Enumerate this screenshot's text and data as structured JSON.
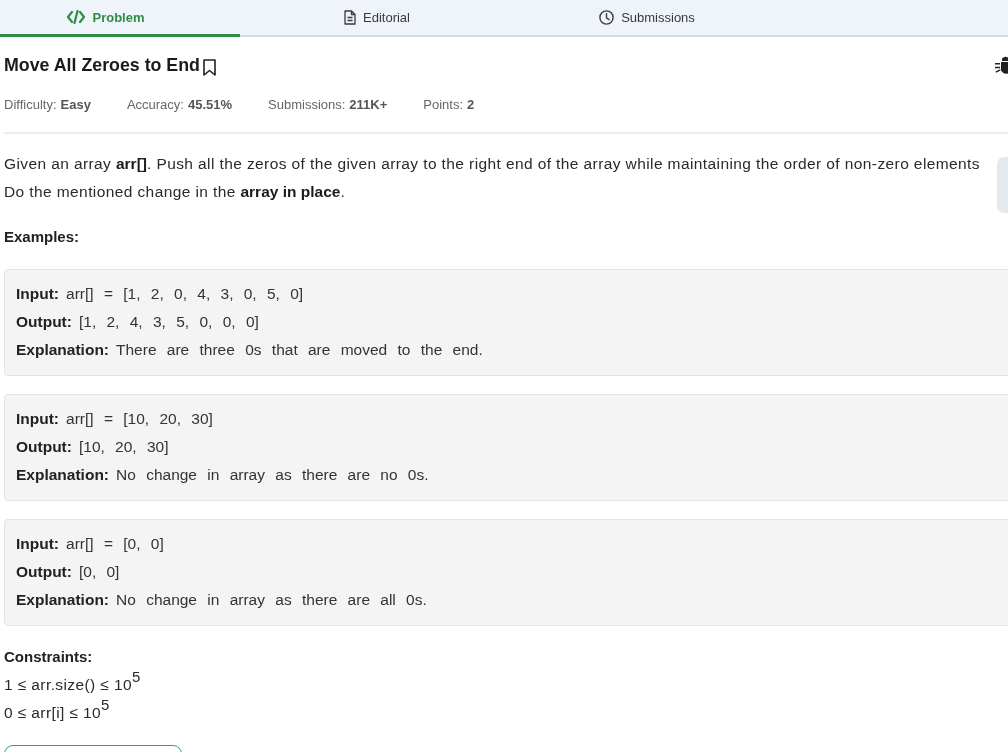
{
  "tabs": [
    {
      "label": "Problem",
      "selected": true
    },
    {
      "label": "Editorial",
      "selected": false
    },
    {
      "label": "Submissions",
      "selected": false
    }
  ],
  "problem": {
    "title": "Move All Zeroes to End",
    "meta": [
      {
        "label": "Difficulty:",
        "value": "Easy"
      },
      {
        "label": "Accuracy:",
        "value": "45.51%"
      },
      {
        "label": "Submissions:",
        "value": "211K+"
      },
      {
        "label": "Points:",
        "value": "2"
      }
    ]
  },
  "description_lines": [
    "Given an array **arr[]**. Push all the zeros of the given array to the right end of the array while maintaining the order of non-zero elements",
    "Do the mentioned change in the **array in place**."
  ],
  "examples_heading": "Examples:",
  "examples": [
    {
      "lines": [
        {
          "label": "Input:",
          "value": "arr[] = [1, 2, 0, 4, 3, 0, 5, 0]"
        },
        {
          "label": "Output:",
          "value": "[1, 2, 4, 3, 5, 0, 0, 0]"
        },
        {
          "label": "Explanation:",
          "value": "There are three 0s that are moved to the end."
        }
      ]
    },
    {
      "lines": [
        {
          "label": "Input:",
          "value": "arr[] = [10, 20, 30]"
        },
        {
          "label": "Output:",
          "value": "[10, 20, 30]"
        },
        {
          "label": "Explanation:",
          "value": "No change in array as there are no 0s."
        }
      ]
    },
    {
      "lines": [
        {
          "label": "Input:",
          "value": "arr[] = [0, 0]"
        },
        {
          "label": "Output:",
          "value": "[0, 0]"
        },
        {
          "label": "Explanation:",
          "value": "No change in array as there are all 0s."
        }
      ]
    }
  ],
  "constraints": {
    "heading": "Constraints:",
    "lines": [
      "1 ≤ arr.size() ≤ 10$^{5}$",
      "0 ≤ arr[i] ≤ 10$^{5}$"
    ]
  }
}
